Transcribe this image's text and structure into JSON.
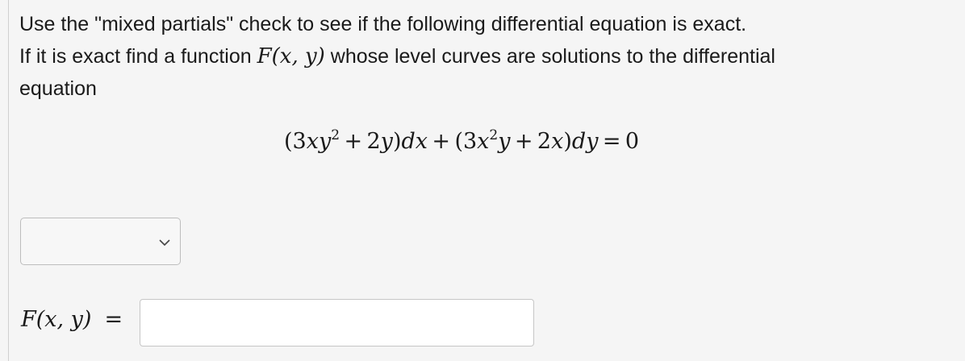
{
  "question": {
    "line1": "Use the \"mixed partials\" check to see if the following differential equation is exact.",
    "line2_before": "If it is exact find a function ",
    "line2_fn": "F(x, y)",
    "line2_after": " whose level curves are solutions to the differential",
    "line3": "equation"
  },
  "equation": {
    "text": "(3xy² + 2y)dx + (3x²y + 2x)dy = 0"
  },
  "exactness_select": {
    "selected_value": ""
  },
  "answer": {
    "label": "F(x, y)",
    "equals": "=",
    "value": ""
  }
}
